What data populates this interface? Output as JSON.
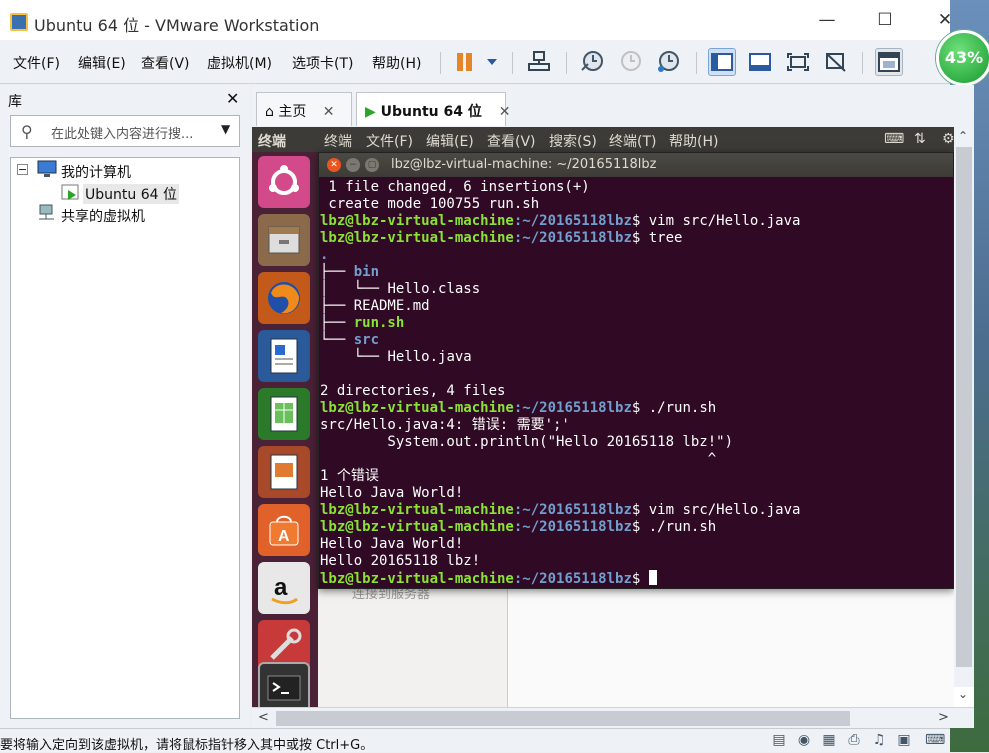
{
  "window": {
    "title": "Ubuntu 64 位 - VMware Workstation",
    "minimize": "—",
    "maximize": "☐",
    "close": "✕"
  },
  "menubar": {
    "items": [
      "文件(F)",
      "编辑(E)",
      "查看(V)",
      "虚拟机(M)",
      "选项卡(T)",
      "帮助(H)"
    ]
  },
  "cpu_indicator": "43%",
  "library": {
    "title": "库",
    "close": "✕",
    "search_placeholder": "在此处键入内容进行搜...",
    "tree": {
      "my_computer": "我的计算机",
      "vm": "Ubuntu 64 位",
      "shared": "共享的虚拟机"
    }
  },
  "tabs": [
    {
      "label": "主页",
      "close": "✕"
    },
    {
      "label": "Ubuntu 64 位",
      "close": "✕"
    }
  ],
  "ubuntu": {
    "app_name": "终端",
    "menu": [
      "终端",
      "文件(F)",
      "编辑(E)",
      "查看(V)",
      "搜索(S)",
      "终端(T)",
      "帮助(H)"
    ],
    "background_ghost": "连接到服务器"
  },
  "terminal": {
    "title": "lbz@lbz-virtual-machine: ~/20165118lbz",
    "prompt_user": "lbz@lbz-virtual-machine",
    "prompt_path": ":~/20165118lbz",
    "prompt_end": "$ ",
    "lines": {
      "l1": " 1 file changed, 6 insertions(+)",
      "l2": " create mode 100755 run.sh",
      "c1": "vim src/Hello.java",
      "c2": "tree",
      "t0": ".",
      "t1_pre": "├── ",
      "t1": "bin",
      "t2_pre": "│   └── ",
      "t2": "Hello.class",
      "t3_pre": "├── ",
      "t3": "README.md",
      "t4_pre": "├── ",
      "t4": "run.sh",
      "t5_pre": "└── ",
      "t5": "src",
      "t6_pre": "    └── ",
      "t6": "Hello.java",
      "summary": "2 directories, 4 files",
      "c3": "./run.sh",
      "err1": "src/Hello.java:4: 错误: 需要';'",
      "err2": "        System.out.println(\"Hello 20165118 lbz!\")",
      "err3": "                                              ^",
      "err4": "1 个错误",
      "out1": "Hello Java World!",
      "c4": "vim src/Hello.java",
      "c5": "./run.sh",
      "out2": "Hello Java World!",
      "out3": "Hello 20165118 lbz!"
    }
  },
  "status": {
    "text": "要将输入定向到该虚拟机，请将鼠标指针移入其中或按 Ctrl+G。"
  },
  "colors": {
    "terminal_bg": "#300a24",
    "prompt_user": "#8ae234",
    "prompt_path": "#729fcf",
    "launcher_bg": "#4a2137"
  }
}
